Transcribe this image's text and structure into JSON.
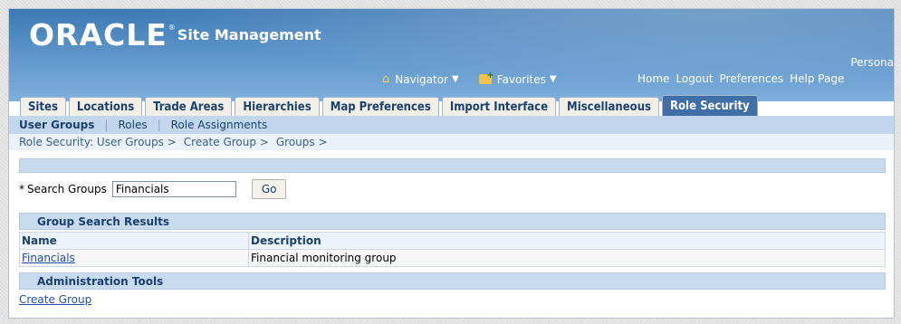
{
  "header": {
    "logo": "ORACLE",
    "logo_mark": "®",
    "app_name": "Site Management",
    "persona": "Persona",
    "navigator": "Navigator",
    "favorites": "Favorites",
    "links": [
      "Home",
      "Logout",
      "Preferences",
      "Help Page"
    ]
  },
  "tabs": [
    {
      "label": "Sites",
      "active": false
    },
    {
      "label": "Locations",
      "active": false
    },
    {
      "label": "Trade Areas",
      "active": false
    },
    {
      "label": "Hierarchies",
      "active": false
    },
    {
      "label": "Map Preferences",
      "active": false
    },
    {
      "label": "Import Interface",
      "active": false
    },
    {
      "label": "Miscellaneous",
      "active": false
    },
    {
      "label": "Role Security",
      "active": true
    }
  ],
  "subtabs": {
    "items": [
      "User Groups",
      "Roles",
      "Role Assignments"
    ],
    "active": "User Groups",
    "separator": "|"
  },
  "breadcrumb": [
    "Role Security: User Groups >",
    "Create Group >",
    "Groups >"
  ],
  "search": {
    "required_mark": "*",
    "label": "Search Groups",
    "value": "Financials",
    "go_label": "Go"
  },
  "results": {
    "title": "Group Search Results",
    "columns": [
      "Name",
      "Description"
    ],
    "rows": [
      {
        "name": "Financials",
        "description": "Financial monitoring group"
      }
    ]
  },
  "admin": {
    "title": "Administration Tools",
    "create_label": "Create Group"
  },
  "colors": {
    "header_top": "#3c78b4",
    "active_tab": "#3f6fa6",
    "band": "#c8daee",
    "link": "#2550a8"
  }
}
